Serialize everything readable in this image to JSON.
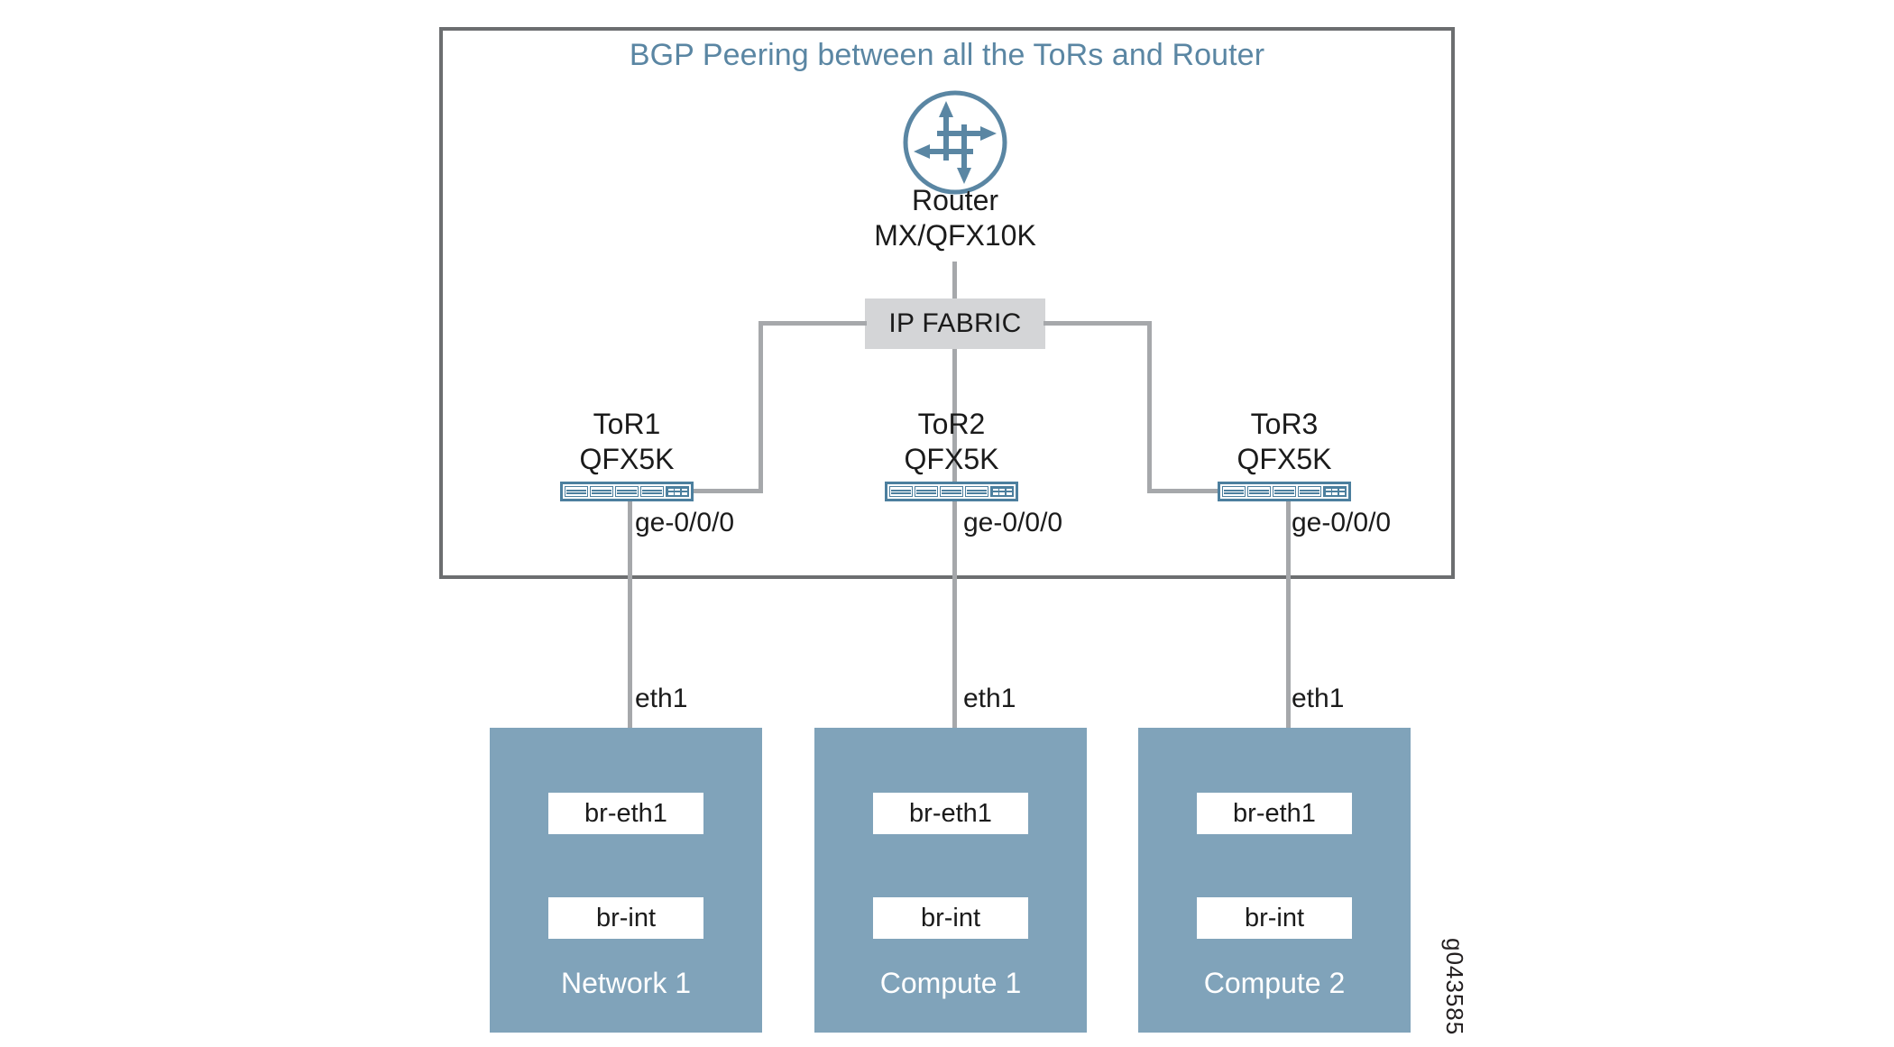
{
  "figure": {
    "title": "BGP Peering between all the ToRs and Router",
    "reference_id": "g043585",
    "title_color": "#5a86a3",
    "frame_color": "#6c6e70",
    "line_color": "#a6a8ab",
    "node_fill": "#80a3ba",
    "fabric_fill": "#d4d5d7",
    "switch_accent": "#4c7f9e"
  },
  "router": {
    "icon": "router-icon",
    "name": "Router",
    "model": "MX/QFX10K"
  },
  "fabric": {
    "label": "IP FABRIC"
  },
  "tors": [
    {
      "name": "ToR1",
      "model": "QFX5K",
      "interface": "ge-0/0/0",
      "icon": "switch-icon"
    },
    {
      "name": "ToR2",
      "model": "QFX5K",
      "interface": "ge-0/0/0",
      "icon": "switch-icon"
    },
    {
      "name": "ToR3",
      "model": "QFX5K",
      "interface": "ge-0/0/0",
      "icon": "switch-icon"
    }
  ],
  "host_links": [
    {
      "label": "eth1"
    },
    {
      "label": "eth1"
    },
    {
      "label": "eth1"
    }
  ],
  "nodes": [
    {
      "name": "Network 1",
      "bridges": [
        "br-eth1",
        "br-int"
      ]
    },
    {
      "name": "Compute 1",
      "bridges": [
        "br-eth1",
        "br-int"
      ]
    },
    {
      "name": "Compute 2",
      "bridges": [
        "br-eth1",
        "br-int"
      ]
    }
  ]
}
